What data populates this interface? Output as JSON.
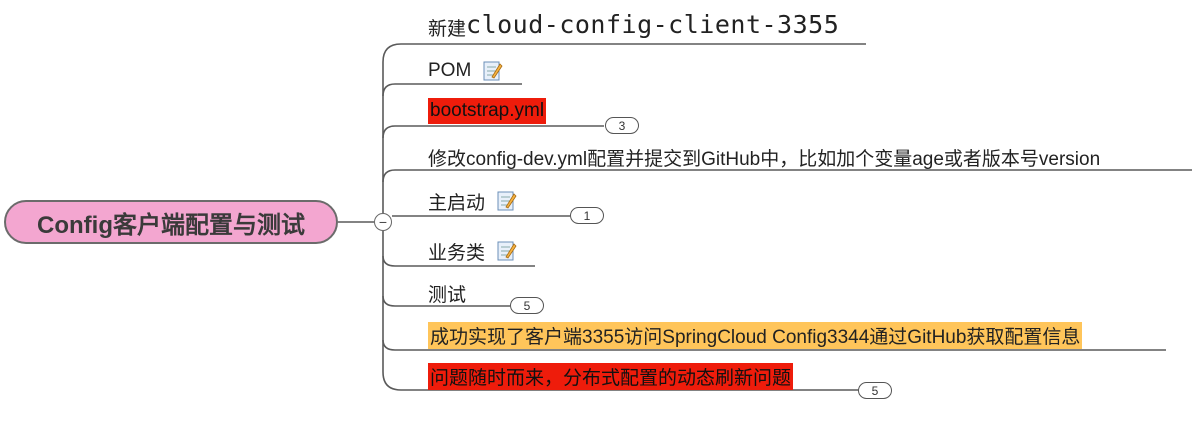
{
  "root": {
    "label": "Config客户端配置与测试",
    "fill": "#f3a6d0"
  },
  "collapse_symbol": "−",
  "topics": [
    {
      "prefix": "新建",
      "label": "cloud-config-client-3355",
      "style": "underline"
    },
    {
      "label": "POM",
      "icon": "note-icon",
      "style": "underline"
    },
    {
      "label": "bootstrap.yml",
      "style": "red",
      "count": "3"
    },
    {
      "label": "修改config-dev.yml配置并提交到GitHub中，比如加个变量age或者版本号version",
      "style": "underline"
    },
    {
      "label": "主启动",
      "icon": "note-icon",
      "style": "underline",
      "count": "1"
    },
    {
      "label": "业务类",
      "icon": "note-icon",
      "style": "underline"
    },
    {
      "label": "测试",
      "style": "underline",
      "count": "5"
    },
    {
      "label": "成功实现了客户端3355访问SpringCloud Config3344通过GitHub获取配置信息",
      "style": "orange"
    },
    {
      "label": "问题随时而来，分布式配置的动态刷新问题",
      "style": "red",
      "count": "5"
    }
  ],
  "colors": {
    "red": "#ee1c0b",
    "orange": "#ffc55a",
    "connector": "#5a5a5a"
  }
}
